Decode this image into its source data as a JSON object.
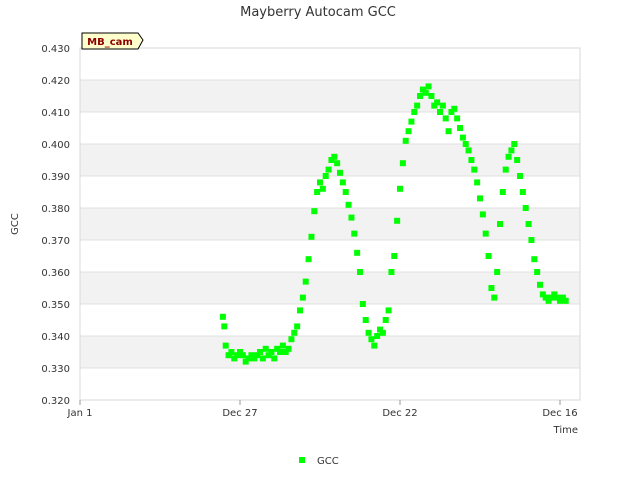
{
  "chart_data": {
    "type": "scatter",
    "title": "Mayberry Autocam GCC",
    "xlabel": "Time",
    "ylabel": "GCC",
    "badge": "MB_cam",
    "ylim": [
      0.32,
      0.43
    ],
    "yticks": [
      "0.320",
      "0.330",
      "0.340",
      "0.350",
      "0.360",
      "0.370",
      "0.380",
      "0.390",
      "0.400",
      "0.410",
      "0.420",
      "0.430"
    ],
    "xlim_days": [
      0,
      350
    ],
    "xticks": [
      {
        "label": "Jan 1",
        "day": 0
      },
      {
        "label": "Dec 27",
        "day": 112
      },
      {
        "label": "Dec 22",
        "day": 224
      },
      {
        "label": "Dec 16",
        "day": 336
      }
    ],
    "grid": true,
    "legend": "bottom-center",
    "colors": {
      "series": "#00ff00",
      "band": "#f2f2f2",
      "grid": "#e0e0e0",
      "badge_bg": "#ffffcc"
    },
    "series": [
      {
        "name": "GCC",
        "x": [
          100,
          101,
          102,
          104,
          106,
          108,
          110,
          112,
          114,
          116,
          118,
          120,
          122,
          124,
          126,
          128,
          130,
          132,
          134,
          136,
          138,
          140,
          142,
          144,
          146,
          148,
          150,
          152,
          154,
          156,
          158,
          160,
          162,
          164,
          166,
          168,
          170,
          172,
          174,
          176,
          178,
          180,
          182,
          184,
          186,
          188,
          190,
          192,
          194,
          196,
          198,
          200,
          202,
          204,
          206,
          208,
          210,
          212,
          214,
          216,
          218,
          220,
          222,
          224,
          226,
          228,
          230,
          232,
          234,
          236,
          238,
          240,
          242,
          244,
          246,
          248,
          250,
          252,
          254,
          256,
          258,
          260,
          262,
          264,
          266,
          268,
          270,
          272,
          274,
          276,
          278,
          280,
          282,
          284,
          286,
          288,
          290,
          292,
          294,
          296,
          298,
          300,
          302,
          304,
          306,
          308,
          310,
          312,
          314,
          316,
          318,
          320,
          322,
          324,
          326,
          328,
          330,
          332,
          334,
          336,
          338,
          340
        ],
        "y": [
          0.346,
          0.343,
          0.337,
          0.334,
          0.335,
          0.333,
          0.334,
          0.335,
          0.334,
          0.332,
          0.333,
          0.334,
          0.333,
          0.334,
          0.335,
          0.333,
          0.336,
          0.334,
          0.335,
          0.333,
          0.336,
          0.335,
          0.337,
          0.335,
          0.336,
          0.339,
          0.341,
          0.343,
          0.348,
          0.352,
          0.357,
          0.364,
          0.371,
          0.379,
          0.385,
          0.388,
          0.386,
          0.39,
          0.392,
          0.395,
          0.396,
          0.394,
          0.391,
          0.388,
          0.385,
          0.381,
          0.377,
          0.372,
          0.366,
          0.36,
          0.35,
          0.345,
          0.341,
          0.339,
          0.337,
          0.34,
          0.342,
          0.341,
          0.345,
          0.348,
          0.36,
          0.365,
          0.376,
          0.386,
          0.394,
          0.401,
          0.404,
          0.407,
          0.41,
          0.412,
          0.415,
          0.417,
          0.416,
          0.418,
          0.415,
          0.412,
          0.413,
          0.41,
          0.412,
          0.408,
          0.404,
          0.41,
          0.411,
          0.408,
          0.405,
          0.402,
          0.4,
          0.398,
          0.395,
          0.392,
          0.388,
          0.383,
          0.378,
          0.372,
          0.365,
          0.355,
          0.352,
          0.36,
          0.375,
          0.385,
          0.392,
          0.396,
          0.398,
          0.4,
          0.395,
          0.39,
          0.385,
          0.38,
          0.375,
          0.37,
          0.364,
          0.36,
          0.356,
          0.353,
          0.352,
          0.351,
          0.352,
          0.353,
          0.352,
          0.351,
          0.352,
          0.351
        ]
      }
    ]
  }
}
